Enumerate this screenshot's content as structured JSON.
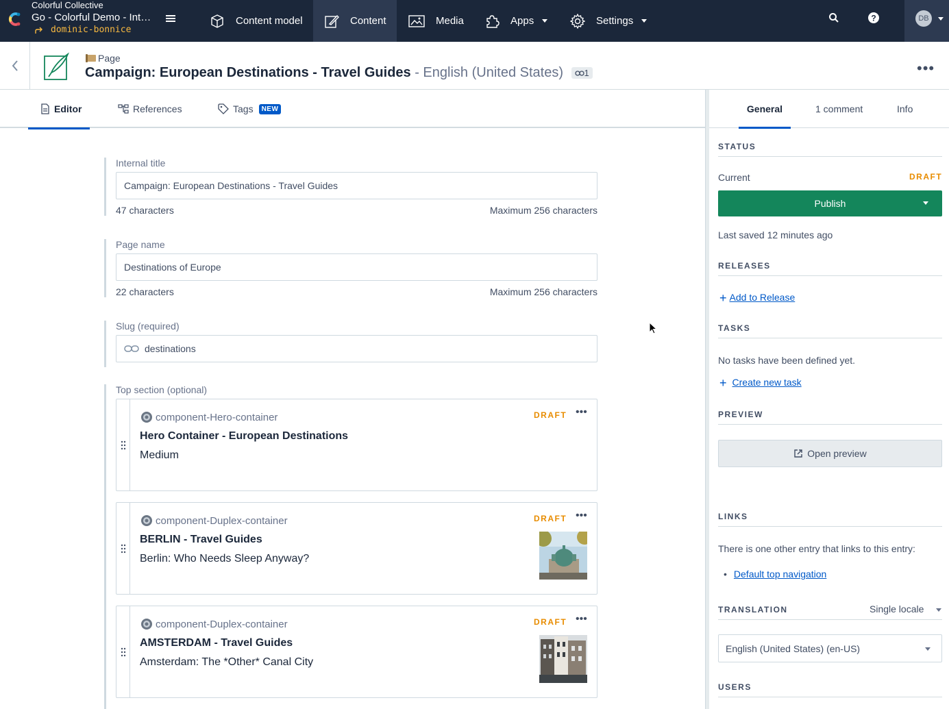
{
  "nav": {
    "org_name": "Colorful Collective",
    "space_name": "Go - Colorful Demo - Inte...",
    "environment": "dominic-bonnice",
    "items": [
      {
        "label": "Content model",
        "icon": "cube-icon"
      },
      {
        "label": "Content",
        "icon": "pencil-icon",
        "active": true
      },
      {
        "label": "Media",
        "icon": "image-icon"
      },
      {
        "label": "Apps",
        "icon": "puzzle-icon"
      },
      {
        "label": "Settings",
        "icon": "gear-icon"
      }
    ],
    "avatar_initials": "DB"
  },
  "entry": {
    "content_type": "Page",
    "title": "Campaign: European Destinations - Travel Guides",
    "locale_suffix": "- English (United States)",
    "link_count": "1"
  },
  "editor_tabs": {
    "editor": "Editor",
    "references": "References",
    "tags": "Tags",
    "new_badge": "NEW"
  },
  "fields": {
    "internal_title": {
      "label": "Internal title",
      "value": "Campaign: European Destinations - Travel Guides",
      "count": "47 characters",
      "max": "Maximum 256 characters"
    },
    "page_name": {
      "label": "Page name",
      "value": "Destinations of Europe",
      "count": "22 characters",
      "max": "Maximum 256 characters"
    },
    "slug": {
      "label": "Slug (required)",
      "value": "destinations"
    },
    "top_section": {
      "label": "Top section (optional)",
      "cards": [
        {
          "type": "component-Hero-container",
          "title": "Hero Container - European Destinations",
          "subtitle": "Medium",
          "status": "DRAFT"
        },
        {
          "type": "component-Duplex-container",
          "title": "BERLIN - Travel Guides",
          "subtitle": "Berlin: Who Needs Sleep Anyway?",
          "status": "DRAFT"
        },
        {
          "type": "component-Duplex-container",
          "title": "AMSTERDAM - Travel Guides",
          "subtitle": "Amsterdam: The *Other* Canal City",
          "status": "DRAFT"
        }
      ]
    }
  },
  "sidebar": {
    "tabs": {
      "general": "General",
      "comments": "1 comment",
      "info": "Info"
    },
    "status": {
      "heading": "STATUS",
      "current_label": "Current",
      "current_value": "DRAFT",
      "publish_label": "Publish",
      "last_saved": "Last saved 12 minutes ago"
    },
    "releases": {
      "heading": "RELEASES",
      "add_link": "Add to Release"
    },
    "tasks": {
      "heading": "TASKS",
      "empty": "No tasks have been defined yet.",
      "create_link": "Create new task"
    },
    "preview": {
      "heading": "PREVIEW",
      "button": "Open preview"
    },
    "links": {
      "heading": "LINKS",
      "text": "There is one other entry that links to this entry:",
      "items": [
        "Default top navigation"
      ]
    },
    "translation": {
      "heading": "TRANSLATION",
      "mode": "Single locale",
      "locale": "English (United States) (en-US)"
    },
    "users": {
      "heading": "USERS"
    }
  },
  "colors": {
    "nav_bg": "#1b273a",
    "accent_blue": "#0059c8",
    "publish_green": "#14865b",
    "draft_orange": "#e88c00",
    "env_yellow": "#f7b840"
  }
}
